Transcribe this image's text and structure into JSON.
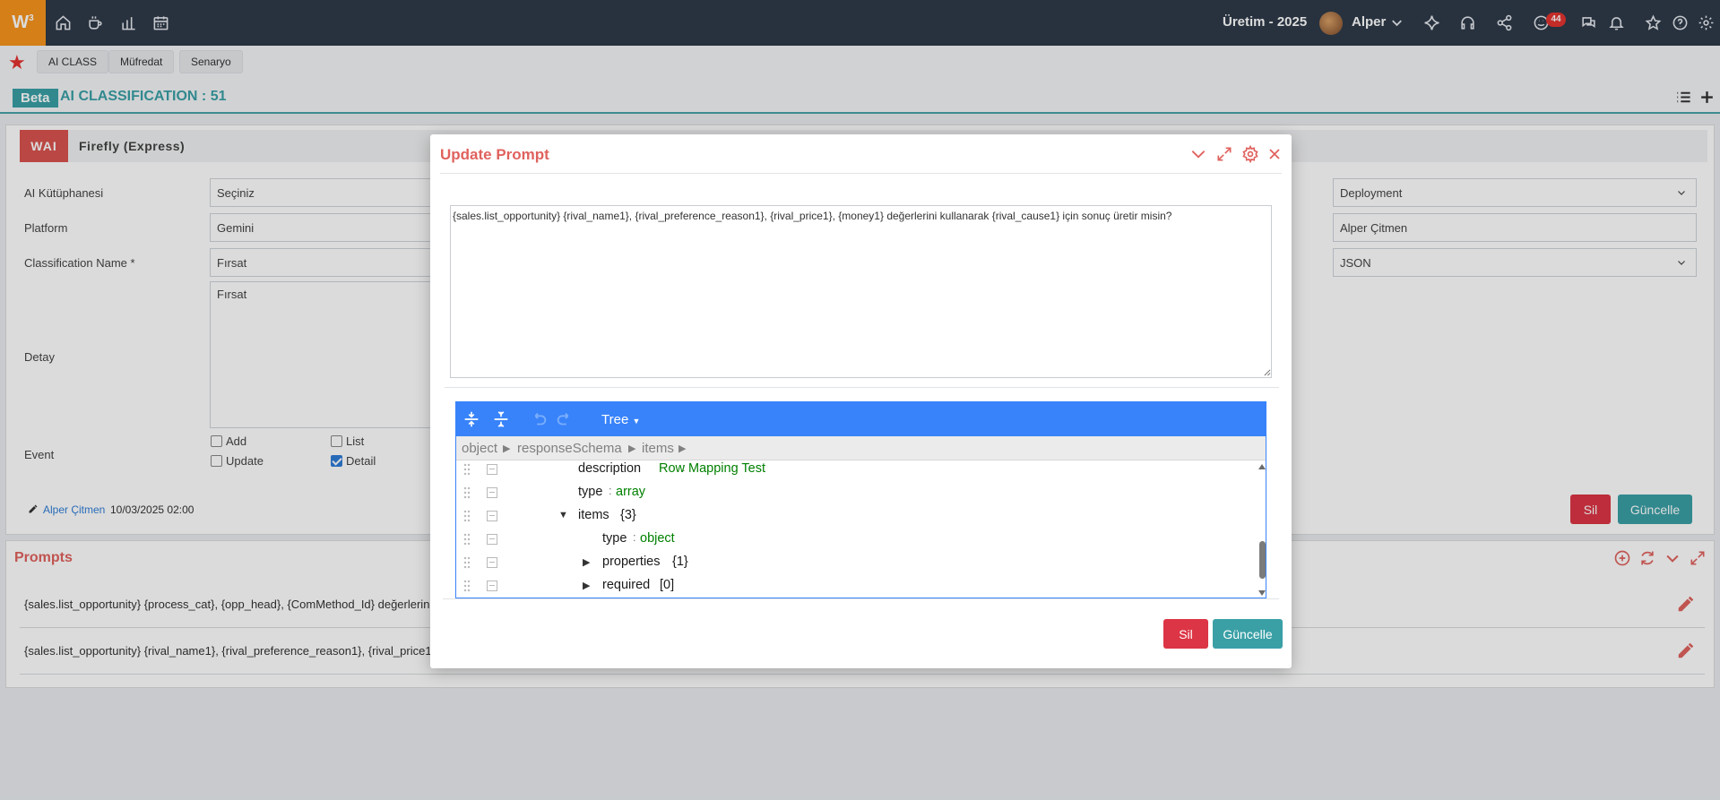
{
  "topbar": {
    "logo": "W",
    "logo_sup": "3",
    "period": "Üretim - 2025",
    "user": "Alper",
    "notifications": "44"
  },
  "tabs": [
    "AI CLASS",
    "Müfredat",
    "Senaryo"
  ],
  "page": {
    "badge": "Beta",
    "title": "AI CLASSIFICATION : 51"
  },
  "panel": {
    "badge": "WAI",
    "name": "Firefly (Express)",
    "fields": {
      "library_label": "AI Kütüphanesi",
      "library_value": "Seçiniz",
      "platform_label": "Platform",
      "platform_value": "Gemini",
      "classname_label": "Classification Name *",
      "classname_value": "Fırsat",
      "detail_label": "Detay",
      "detail_value": "Fırsat",
      "event_label": "Event",
      "right1": "Deployment",
      "right2": "Alper Çitmen",
      "right3": "JSON"
    },
    "events": {
      "add": "Add",
      "list": "List",
      "update": "Update",
      "detail": "Detail"
    },
    "author": "Alper Çitmen",
    "date": "10/03/2025 02:00",
    "delete_label": "Sil",
    "update_label": "Güncelle"
  },
  "prompts": {
    "title": "Prompts",
    "rows": [
      "{sales.list_opportunity} {process_cat}, {opp_head}, {ComMethod_Id} değerlerini",
      "{sales.list_opportunity} {rival_name1}, {rival_preference_reason1}, {rival_price1}"
    ]
  },
  "modal": {
    "title": "Update Prompt",
    "prompt_text": "{sales.list_opportunity} {rival_name1}, {rival_preference_reason1}, {rival_price1}, {money1} değerlerini kullanarak {rival_cause1} için sonuç üretir misin?",
    "editor": {
      "mode": "Tree",
      "breadcrumb": [
        "object",
        "responseSchema",
        "items"
      ],
      "rows": {
        "r1_key": "description",
        "r1_val": "Row Mapping Test",
        "r2_key": "type",
        "r2_val": "array",
        "r3_key": "items",
        "r3_count": "{3}",
        "r4_key": "type",
        "r4_val": "object",
        "r5_key": "properties",
        "r5_count": "{1}",
        "r6_key": "required",
        "r6_count": "[0]"
      }
    },
    "delete_label": "Sil",
    "update_label": "Güncelle"
  },
  "colors": {
    "topbar": "#2f3b4a",
    "logo": "#f7941d",
    "accent_teal": "#3aa0a6",
    "accent_red": "#dc3545",
    "title_red": "#e0625e",
    "editor_blue": "#3883fa"
  }
}
